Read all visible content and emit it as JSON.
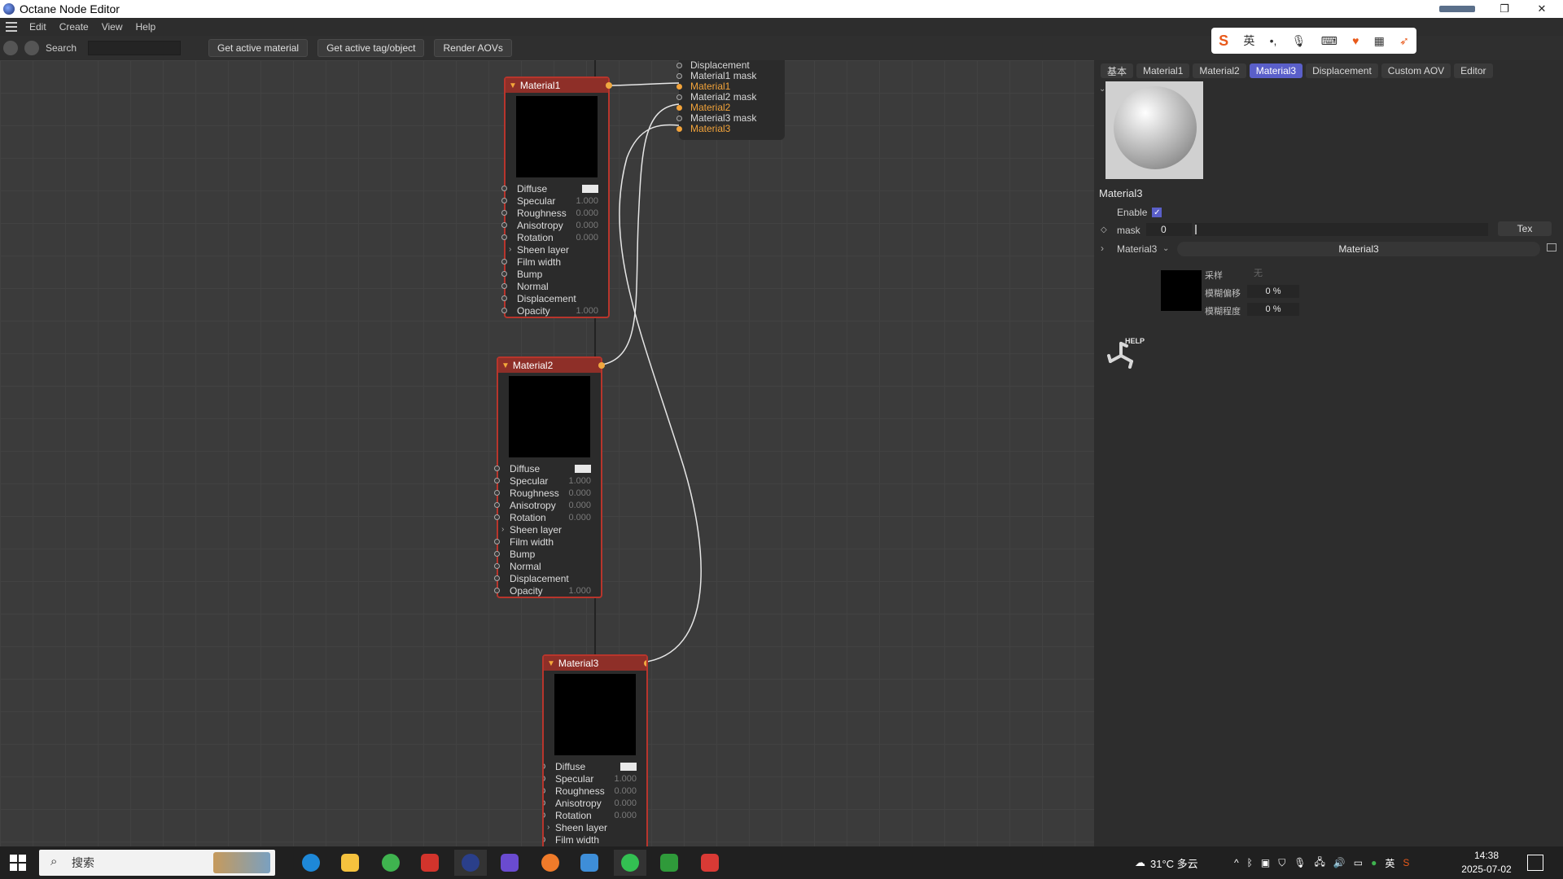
{
  "window": {
    "title": "Octane Node Editor"
  },
  "menu": [
    "Edit",
    "Create",
    "View",
    "Help"
  ],
  "toolbar": {
    "search_label": "Search",
    "buttons": [
      "Get active material",
      "Get active tag/object",
      "Render AOVs"
    ]
  },
  "aov_node": {
    "rows": [
      {
        "label": "Displacement",
        "highlight": false
      },
      {
        "label": "Material1 mask",
        "highlight": false
      },
      {
        "label": "Material1",
        "highlight": true
      },
      {
        "label": "Material2 mask",
        "highlight": false
      },
      {
        "label": "Material2",
        "highlight": true
      },
      {
        "label": "Material3 mask",
        "highlight": false
      },
      {
        "label": "Material3",
        "highlight": true
      }
    ]
  },
  "nodes": [
    {
      "title": "Material1",
      "params": [
        {
          "label": "Diffuse",
          "value": "swatch"
        },
        {
          "label": "Specular",
          "value": "1.000"
        },
        {
          "label": "Roughness",
          "value": "0.000"
        },
        {
          "label": "Anisotropy",
          "value": "0.000"
        },
        {
          "label": "Rotation",
          "value": "0.000"
        },
        {
          "label": "Sheen layer",
          "value": ""
        },
        {
          "label": "Film width",
          "value": ""
        },
        {
          "label": "Bump",
          "value": ""
        },
        {
          "label": "Normal",
          "value": ""
        },
        {
          "label": "Displacement",
          "value": ""
        },
        {
          "label": "Opacity",
          "value": "1.000"
        }
      ]
    },
    {
      "title": "Material2",
      "params": [
        {
          "label": "Diffuse",
          "value": "swatch"
        },
        {
          "label": "Specular",
          "value": "1.000"
        },
        {
          "label": "Roughness",
          "value": "0.000"
        },
        {
          "label": "Anisotropy",
          "value": "0.000"
        },
        {
          "label": "Rotation",
          "value": "0.000"
        },
        {
          "label": "Sheen layer",
          "value": ""
        },
        {
          "label": "Film width",
          "value": ""
        },
        {
          "label": "Bump",
          "value": ""
        },
        {
          "label": "Normal",
          "value": ""
        },
        {
          "label": "Displacement",
          "value": ""
        },
        {
          "label": "Opacity",
          "value": "1.000"
        }
      ]
    },
    {
      "title": "Material3",
      "params": [
        {
          "label": "Diffuse",
          "value": "swatch"
        },
        {
          "label": "Specular",
          "value": "1.000"
        },
        {
          "label": "Roughness",
          "value": "0.000"
        },
        {
          "label": "Anisotropy",
          "value": "0.000"
        },
        {
          "label": "Rotation",
          "value": "0.000"
        },
        {
          "label": "Sheen layer",
          "value": ""
        },
        {
          "label": "Film width",
          "value": ""
        }
      ]
    }
  ],
  "right_panel": {
    "tabs": [
      "基本",
      "Material1",
      "Material2",
      "Material3",
      "Displacement",
      "Custom AOV",
      "Editor"
    ],
    "active_tab": "Material3",
    "material_name": "Material3",
    "enable_label": "Enable",
    "mask_label": "mask",
    "mask_value": "0",
    "tex_button": "Tex",
    "link_label": "Material3",
    "link_value": "Material3",
    "sampler_label": "采样",
    "sampler_value": "无",
    "blur_offset_label": "模糊偏移",
    "blur_offset_value": "0 %",
    "blur_degree_label": "模糊程度",
    "blur_degree_value": "0 %",
    "help_label": "HELP"
  },
  "taskbar": {
    "search_placeholder": "搜索",
    "weather": "31°C 多云",
    "ime_lang": "英",
    "time": "14:38",
    "date": "2025-07-02"
  },
  "ime_toolbar": {
    "lang": "英"
  }
}
